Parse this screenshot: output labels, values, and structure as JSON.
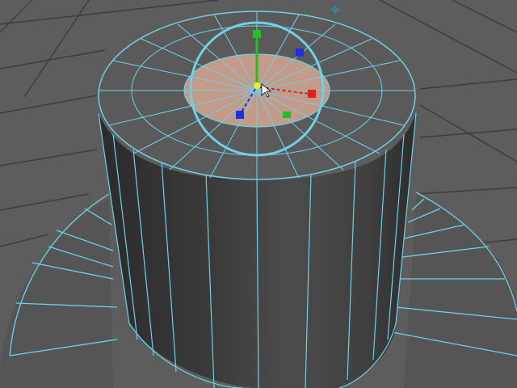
{
  "viewport": {
    "background_color": "#5d5d5d",
    "grid_color": "#3e3e3e",
    "wireframe_color": "#6fd0e6",
    "selected_face_color": "#c49a88",
    "cylinder_shade_dark": "#2d2d2d",
    "cylinder_shade_light": "#545454"
  },
  "manipulator": {
    "type": "universal-manipulator",
    "x_axis_color": "#e02020",
    "y_axis_color": "#20c020",
    "z_axis_color": "#2030e0",
    "center_color": "#f0f020",
    "rotate_ring_color": "#6fd0e6",
    "scale_handle_icon": "square-icon",
    "cursor_icon": "arrow-cursor-icon"
  },
  "headsup": {
    "compass_icon": "gear-icon"
  }
}
